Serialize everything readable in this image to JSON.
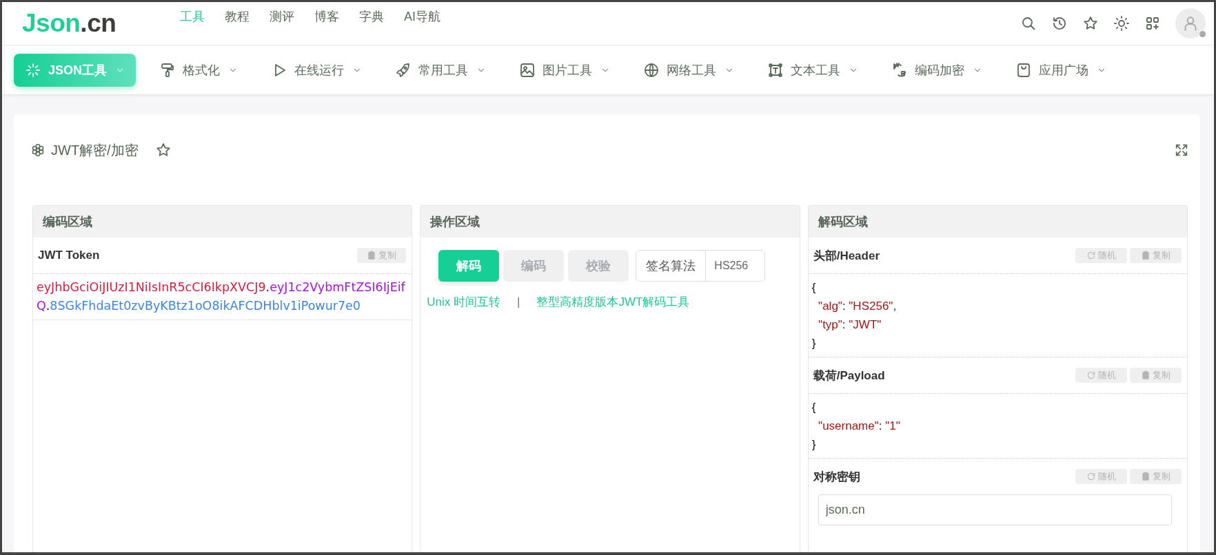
{
  "logo": {
    "main": "Json",
    "suffix": ".cn"
  },
  "top_nav": [
    {
      "label": "工具",
      "selected": true
    },
    {
      "label": "教程",
      "selected": false
    },
    {
      "label": "测评",
      "selected": false
    },
    {
      "label": "博客",
      "selected": false
    },
    {
      "label": "字典",
      "selected": false
    },
    {
      "label": "AI导航",
      "selected": false
    }
  ],
  "tool_nav": [
    {
      "label": "JSON工具",
      "selected": true
    },
    {
      "label": "格式化",
      "selected": false
    },
    {
      "label": "在线运行",
      "selected": false
    },
    {
      "label": "常用工具",
      "selected": false
    },
    {
      "label": "图片工具",
      "selected": false
    },
    {
      "label": "网络工具",
      "selected": false
    },
    {
      "label": "文本工具",
      "selected": false
    },
    {
      "label": "编码加密",
      "selected": false
    },
    {
      "label": "应用广场",
      "selected": false
    }
  ],
  "page_title": "JWT解密/加密",
  "encoded_panel": {
    "title": "编码区域",
    "field_label": "JWT Token",
    "copy_button": "复制",
    "token": [
      {
        "text": "eyJhbGciOiJIUzI1NiIsInR5cCI6IkpXVCJ9",
        "color": "#dc1a3c"
      },
      {
        "text": "."
      },
      {
        "text": "eyJ1c2VybmFtZSI6IjEifQ",
        "color": "#a414d8"
      },
      {
        "text": "."
      },
      {
        "text": "8SGkFhdaEt0zvByKBtz1oO8ikAFCDHblv1iPowur7e0",
        "color": "#3b86dc"
      }
    ]
  },
  "operation_panel": {
    "title": "操作区域",
    "modes": [
      {
        "label": "解码",
        "selected": true
      },
      {
        "label": "编码",
        "selected": false
      },
      {
        "label": "校验",
        "selected": false
      }
    ],
    "algorithm": {
      "label": "签名算法",
      "value": "HS256"
    },
    "links": [
      "Unix 时间互转",
      "整型高精度版本JWT解码工具"
    ],
    "separator": "|"
  },
  "decoded_panel": {
    "title": "解码区域",
    "sections": [
      {
        "kind": "code",
        "title": "头部/Header",
        "random_button": "随机",
        "copy_button": "复制",
        "code": "{\n  \"alg\": \"HS256\",\n  \"typ\": \"JWT\"\n}"
      },
      {
        "kind": "code",
        "title": "载荷/Payload",
        "random_button": "随机",
        "copy_button": "复制",
        "code": "{\n  \"username\": \"1\"\n}"
      },
      {
        "kind": "input",
        "title": "对称密钥",
        "random_button": "随机",
        "copy_button": "复制",
        "value": "json.cn"
      }
    ]
  }
}
